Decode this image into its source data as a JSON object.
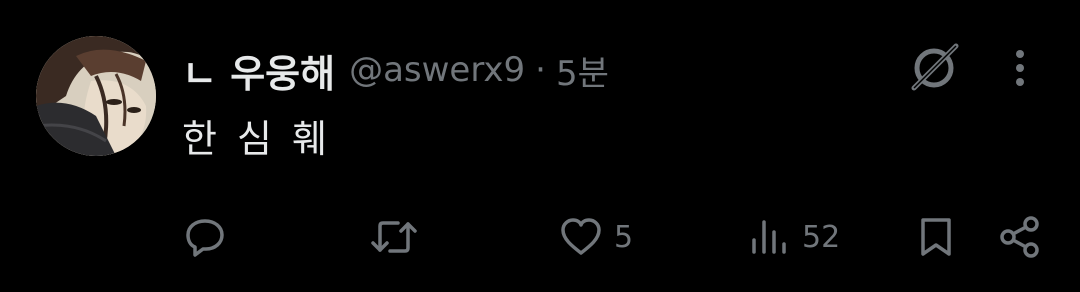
{
  "tweet": {
    "display_name": "ㄴ 우웅해",
    "handle": "@aswerx9",
    "separator": "·",
    "time": "5분",
    "text": "한 심 훼"
  },
  "actions": {
    "reply": {
      "icon": "reply-icon",
      "count": ""
    },
    "retweet": {
      "icon": "retweet-icon",
      "count": ""
    },
    "like": {
      "icon": "heart-icon",
      "count": "5"
    },
    "views": {
      "icon": "analytics-icon",
      "count": "52"
    },
    "bookmark": {
      "icon": "bookmark-icon"
    },
    "share": {
      "icon": "share-icon"
    }
  },
  "header_icons": {
    "grok": "grok-icon",
    "more": "more-options-icon"
  },
  "colors": {
    "background": "#000000",
    "primary_text": "#e7e9ea",
    "secondary_text": "#71767b",
    "icon": "#71767b"
  }
}
